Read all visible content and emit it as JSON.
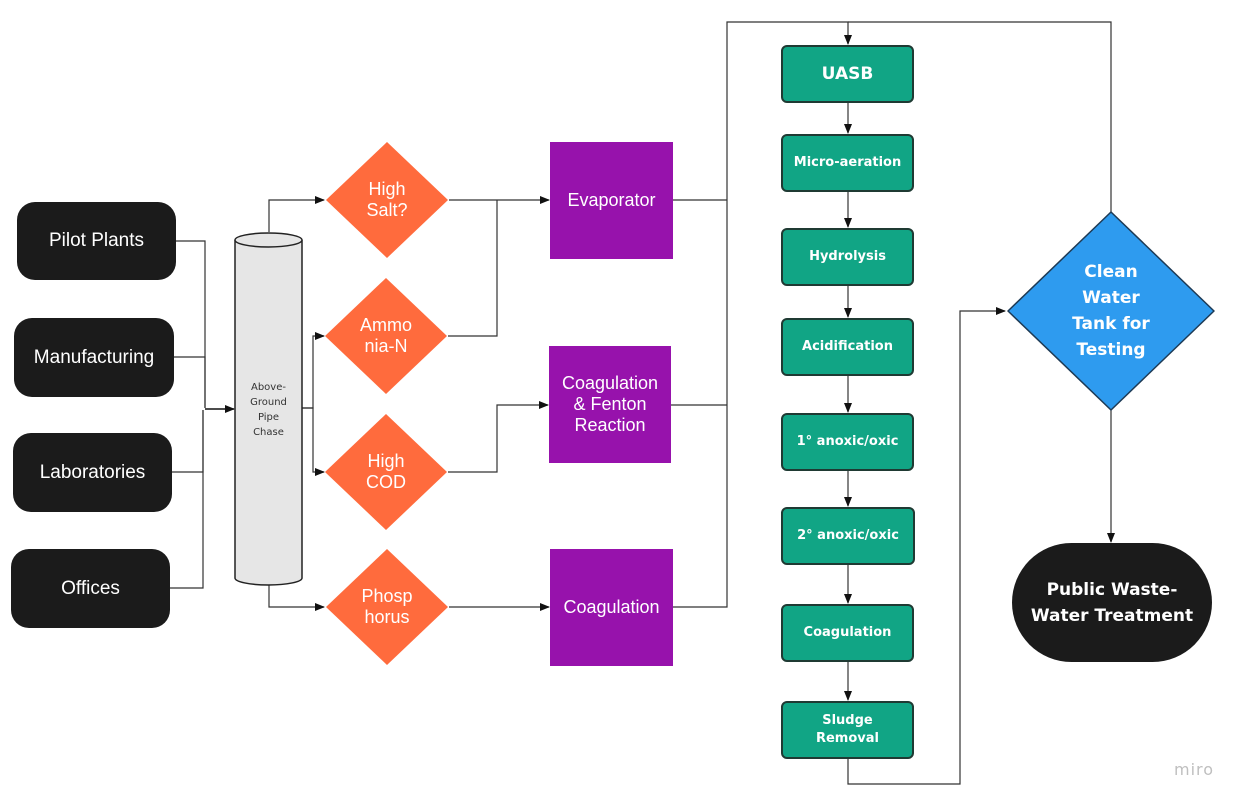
{
  "colors": {
    "source": "#1b1b1b",
    "decision": "#ff6b3d",
    "pretreatment": "#9712ac",
    "process": "#11a585",
    "clean_tank": "#2e9bef",
    "pipe": "#e6e6e6"
  },
  "sources": [
    "Pilot Plants",
    "Manufacturing",
    "Laboratories",
    "Offices"
  ],
  "pipe_chase": "Above-\nGround\nPipe\nChase",
  "decisions": [
    "High\nSalt?",
    "Ammo\nnia-N",
    "High\nCOD",
    "Phosp\nhorus"
  ],
  "pretreatment": [
    "Evaporator",
    "Coagulation\n& Fenton\nReaction",
    "Coagulation"
  ],
  "process_steps": [
    "UASB",
    "Micro-aeration",
    "Hydrolysis",
    "Acidification",
    "1° anoxic/oxic",
    "2° anoxic/oxic",
    "Coagulation",
    "Sludge\nRemoval"
  ],
  "clean_tank": "Clean\nWater\nTank for\nTesting",
  "public": "Public Waste-\nWater Treatment",
  "watermark": "miro"
}
